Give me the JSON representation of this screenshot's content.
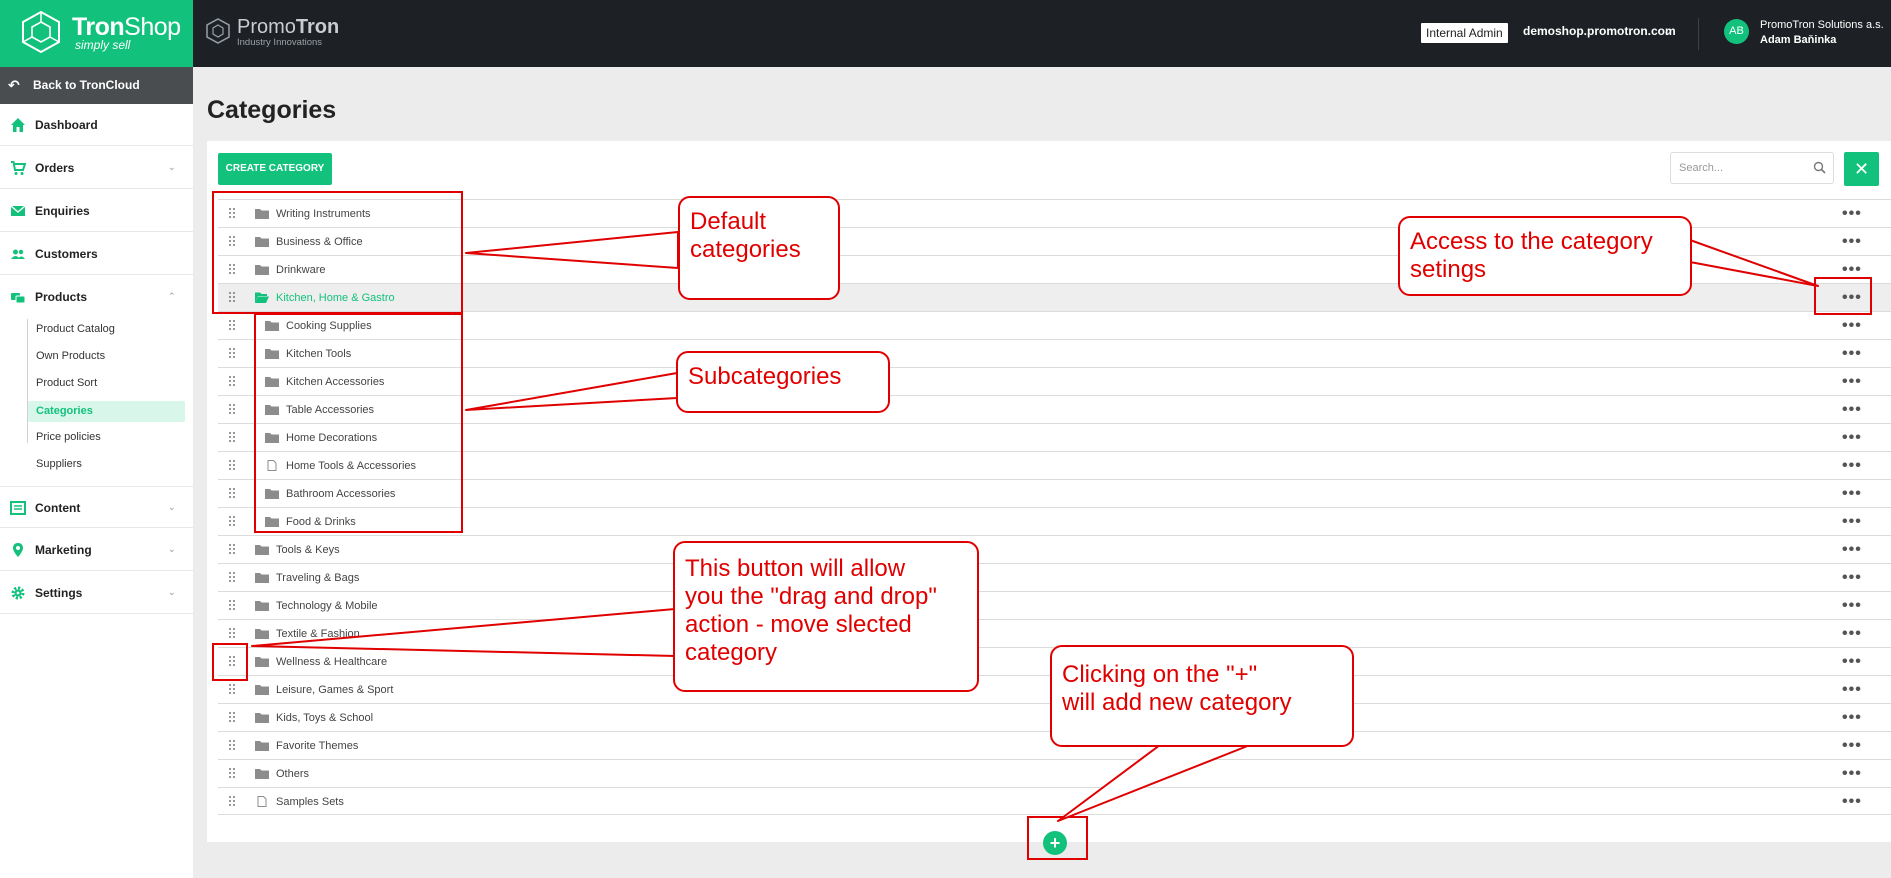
{
  "brand": {
    "name_bold": "Tron",
    "name_rest": "Shop",
    "tagline": "simply sell"
  },
  "partner": {
    "name_light": "Promo",
    "name_bold": "Tron",
    "tagline": "Industry Innovations"
  },
  "header": {
    "admin_badge": "Internal Admin",
    "domain": "demoshop.promotron.com",
    "avatar_initials": "AB",
    "company": "PromoTron Solutions a.s.",
    "user": "Adam Baňinka"
  },
  "sidebar": {
    "back_label": "Back to TronCloud",
    "items": [
      {
        "label": "Dashboard",
        "icon": "home-icon"
      },
      {
        "label": "Orders",
        "icon": "cart-icon"
      },
      {
        "label": "Enquiries",
        "icon": "mail-icon"
      },
      {
        "label": "Customers",
        "icon": "users-icon"
      },
      {
        "label": "Products",
        "icon": "products-icon"
      },
      {
        "label": "Content",
        "icon": "content-icon"
      },
      {
        "label": "Marketing",
        "icon": "map-pin-icon"
      },
      {
        "label": "Settings",
        "icon": "gear-icon"
      }
    ],
    "product_sub": [
      "Product Catalog",
      "Own Products",
      "Product Sort",
      "Categories",
      "Price policies",
      "Suppliers"
    ],
    "active_sub": "Categories"
  },
  "main": {
    "title": "Categories",
    "create_label": "CREATE CATEGORY",
    "search_placeholder": "Search...",
    "categories": [
      {
        "label": "Writing Instruments",
        "icon": "folder"
      },
      {
        "label": "Business & Office",
        "icon": "folder"
      },
      {
        "label": "Drinkware",
        "icon": "folder"
      },
      {
        "label": "Kitchen, Home & Gastro",
        "icon": "folder-open",
        "selected": true
      },
      {
        "label": "Cooking Supplies",
        "icon": "folder",
        "sub": true
      },
      {
        "label": "Kitchen Tools",
        "icon": "folder",
        "sub": true
      },
      {
        "label": "Kitchen Accessories",
        "icon": "folder",
        "sub": true
      },
      {
        "label": "Table Accessories",
        "icon": "folder",
        "sub": true
      },
      {
        "label": "Home Decorations",
        "icon": "folder",
        "sub": true
      },
      {
        "label": "Home Tools & Accessories",
        "icon": "file",
        "sub": true
      },
      {
        "label": "Bathroom Accessories",
        "icon": "folder",
        "sub": true
      },
      {
        "label": "Food & Drinks",
        "icon": "folder",
        "sub": true
      },
      {
        "label": "Tools & Keys",
        "icon": "folder"
      },
      {
        "label": "Traveling & Bags",
        "icon": "folder"
      },
      {
        "label": "Technology & Mobile",
        "icon": "folder"
      },
      {
        "label": "Textile & Fashion",
        "icon": "folder"
      },
      {
        "label": "Wellness & Healthcare",
        "icon": "folder"
      },
      {
        "label": "Leisure, Games & Sport",
        "icon": "folder"
      },
      {
        "label": "Kids, Toys & School",
        "icon": "folder"
      },
      {
        "label": "Favorite Themes",
        "icon": "folder"
      },
      {
        "label": "Others",
        "icon": "folder"
      },
      {
        "label": "Samples Sets",
        "icon": "file"
      }
    ]
  },
  "annotations": {
    "default": "Default\ncategories",
    "settings": "Access to the category\nsetings",
    "sub": "Subcategories",
    "drag": "This button will allow\nyou the \"drag and drop\"\naction - move slected\ncategory",
    "add": "Clicking on the \"+\"\nwill add new category"
  },
  "colors": {
    "accent": "#12c27c",
    "topbar": "#1d2125",
    "annotation": "#e00000"
  }
}
